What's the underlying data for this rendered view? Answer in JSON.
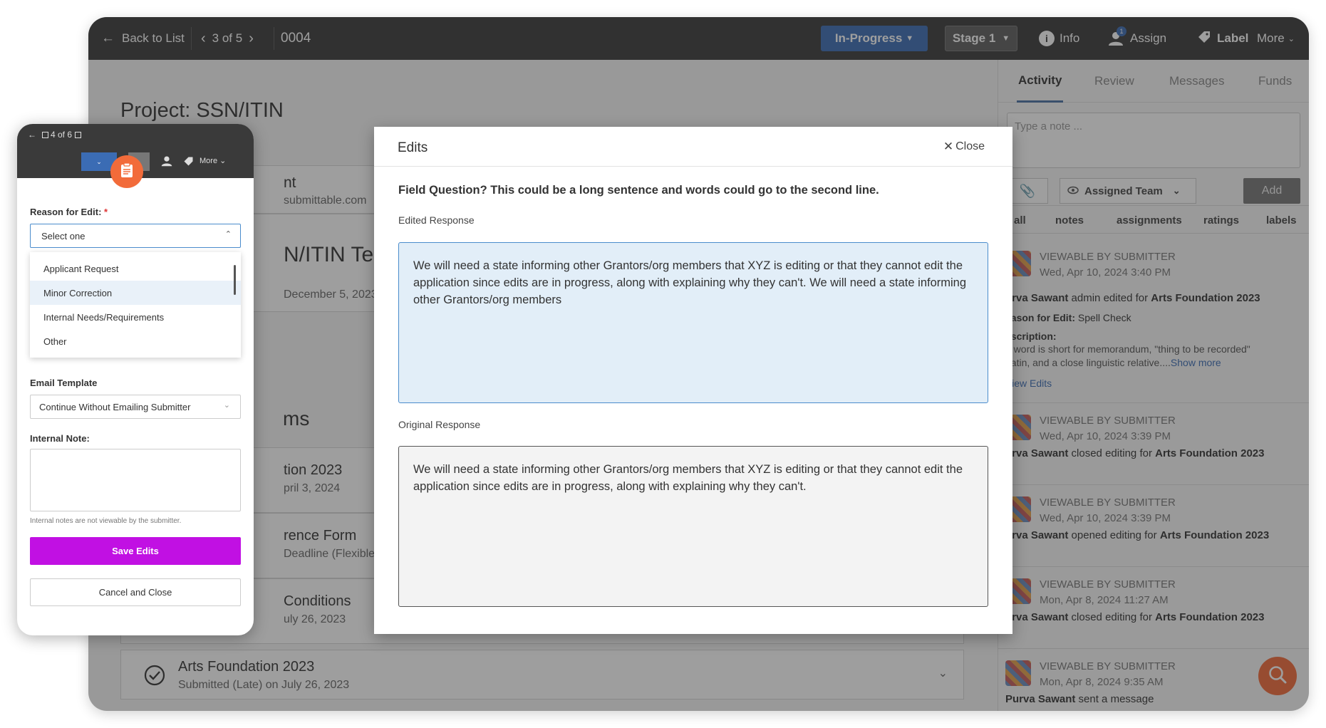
{
  "topbar": {
    "back_label": "Back to List",
    "pager": "3 of 5",
    "record_id": "0004",
    "status_label": "In-Progress",
    "stage_label": "Stage 1",
    "info_label": "Info",
    "assign_label": "Assign",
    "assign_badge": "1",
    "label_label": "Label",
    "more_label": "More"
  },
  "main": {
    "project_title": "Project: SSN/ITIN",
    "email_partial": "submittable.com",
    "nt_partial": "nt",
    "test_title_partial": "N/ITIN Test",
    "date_partial": "December 5, 2023",
    "ms_partial": "ms",
    "items": [
      {
        "title": "tion 2023",
        "sub": "pril 3, 2024"
      },
      {
        "title": "rence Form",
        "sub": "Deadline (Flexible): Sep"
      },
      {
        "title": "Conditions",
        "sub": "uly 26, 2023"
      }
    ],
    "bottom_card": {
      "title": "Arts Foundation 2023",
      "sub": "Submitted (Late) on July 26, 2023"
    }
  },
  "side": {
    "tabs": [
      "Activity",
      "Review",
      "Messages",
      "Funds"
    ],
    "note_placeholder": "Type a note ...",
    "team_label": "Assigned Team",
    "add_label": "Add",
    "filters": [
      "all",
      "notes",
      "assignments",
      "ratings",
      "labels"
    ],
    "activities": [
      {
        "visibility": "VIEWABLE BY SUBMITTER",
        "date": "Wed, Apr 10, 2024 3:40 PM",
        "user": "urva Sawant",
        "action": " admin edited for ",
        "target": "Arts Foundation 2023",
        "reason_label": "eason for Edit:",
        "reason": " Spell Check",
        "desc_label": "escription:",
        "desc1": "e word is short for memorandum, \"thing to be recorded\"",
        "desc2": " Latin, and a close linguistic relative....",
        "show_more": "Show more",
        "view_edits": "View Edits"
      },
      {
        "visibility": "VIEWABLE BY SUBMITTER",
        "date": "Wed, Apr 10, 2024 3:39 PM",
        "user": "urva Sawant",
        "action": " closed editing for ",
        "target": "Arts Foundation 2023"
      },
      {
        "visibility": "VIEWABLE BY SUBMITTER",
        "date": "Wed, Apr 10, 2024 3:39 PM",
        "user": "urva Sawant",
        "action": " opened editing for ",
        "target": "Arts Foundation 2023"
      },
      {
        "visibility": "VIEWABLE BY SUBMITTER",
        "date": "Mon, Apr 8, 2024 11:27 AM",
        "user": "urva Sawant",
        "action": " closed editing for ",
        "target": "Arts Foundation 2023"
      },
      {
        "visibility": "VIEWABLE BY SUBMITTER",
        "date": "Mon, Apr 8, 2024 9:35 AM",
        "user": "Purva Sawant",
        "action": " sent a message",
        "target": ""
      }
    ]
  },
  "modal": {
    "title": "Edits",
    "close_label": "Close",
    "question": "Field Question? This could be a long sentence and words could go to the second line.",
    "edited_label": "Edited Response",
    "edited_text": "We will need a state informing other Grantors/org members that XYZ is editing or that they cannot edit the application since edits are in progress, along with explaining why they can't. We will need a state informing other Grantors/org members",
    "original_label": "Original Response",
    "original_text": "We will need a state informing other Grantors/org members that XYZ is editing or that they cannot edit the application since edits are in progress, along with explaining why they can't."
  },
  "phone": {
    "pager": "4 of 6",
    "more_label": "More",
    "reason_label": "Reason for Edit:",
    "required_mark": "*",
    "select_placeholder": "Select one",
    "options": [
      "Applicant Request",
      "Minor Correction",
      "Internal Needs/Requirements",
      "Other"
    ],
    "highlighted_option": 1,
    "email_template_label": "Email Template",
    "email_template_value": "Continue Without Emailing Submitter",
    "internal_note_label": "Internal Note:",
    "internal_note_help": "Internal notes are not viewable by the submitter.",
    "save_label": "Save Edits",
    "cancel_label": "Cancel and Close"
  },
  "colors": {
    "topbar": "#3a3a3a",
    "status_blue": "#3b6cb4",
    "save_purple": "#c110e3",
    "orange_fab": "#f26b3a",
    "edited_bg": "#e2eef8",
    "edited_border": "#4a8ccc",
    "link_blue": "#3b6cb4"
  }
}
